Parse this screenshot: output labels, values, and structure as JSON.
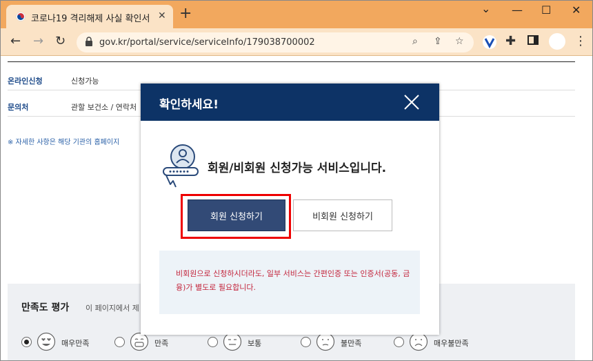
{
  "browser": {
    "tab_title": "코로나19 격리해제 사실 확인서",
    "url": "gov.kr/portal/service/serviceInfo/179038700002"
  },
  "page": {
    "rows": [
      {
        "key": "온라인신청",
        "value": "신청가능"
      },
      {
        "key": "문의처",
        "value": "관할 보건소 / 연락처"
      }
    ],
    "note": "※ 자세한 사항은 해당 기관의 홈페이지 ",
    "satisfaction": {
      "title": "만족도 평가",
      "subtitle": "이 페이지에서 제",
      "options": [
        {
          "label": "매우만족",
          "selected": true
        },
        {
          "label": "만족",
          "selected": false
        },
        {
          "label": "보통",
          "selected": false
        },
        {
          "label": "불만족",
          "selected": false
        },
        {
          "label": "매우불만족",
          "selected": false
        }
      ]
    }
  },
  "modal": {
    "title": "확인하세요!",
    "message": "회원/비회원 신청가능 서비스입니다.",
    "member_button": "회원 신청하기",
    "guest_button": "비회원 신청하기",
    "info_text": "비회원으로 신청하시더라도, 일부 서비스는 간편인증 또는 인증서(공동, 금융)가 별도로 필요합니다."
  },
  "colors": {
    "modal_header": "#0d3366",
    "member_button": "#324a76",
    "info_text": "#c3243b",
    "highlight": "#ee0000"
  }
}
